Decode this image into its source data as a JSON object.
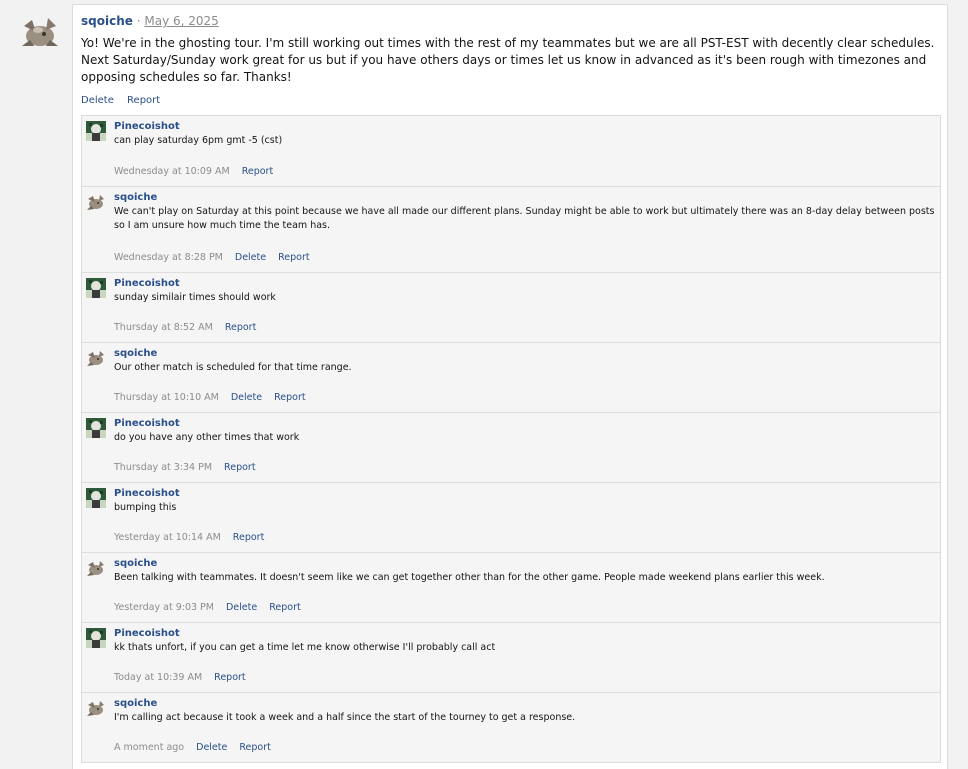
{
  "post": {
    "author": "sqoiche",
    "separator": "·",
    "date": "May 6, 2025",
    "body": "Yo! We're in the ghosting tour. I'm still working out times with the rest of my teammates but we are all PST-EST with decently clear schedules. Next Saturday/Sunday work great for us but if you have others days or times let us know in advanced as it's been rough with timezones and opposing schedules so far. Thanks!",
    "actions": {
      "delete_label": "Delete",
      "report_label": "Report"
    }
  },
  "comments": [
    {
      "author": "Pinecoishot",
      "avatar_icon": "pinecoishot-avatar-icon",
      "text": "can play saturday 6pm gmt -5 (cst)",
      "time": "Wednesday at 10:09 AM",
      "actions": [
        "Report"
      ]
    },
    {
      "author": "sqoiche",
      "avatar_icon": "sqoiche-avatar-icon",
      "text": "We can't play on Saturday at this point because we have all made our different plans. Sunday might be able to work but ultimately there was an 8-day delay between posts so I am unsure how much time the team has.",
      "time": "Wednesday at 8:28 PM",
      "actions": [
        "Delete",
        "Report"
      ]
    },
    {
      "author": "Pinecoishot",
      "avatar_icon": "pinecoishot-avatar-icon",
      "text": "sunday similair times should work",
      "time": "Thursday at 8:52 AM",
      "actions": [
        "Report"
      ]
    },
    {
      "author": "sqoiche",
      "avatar_icon": "sqoiche-avatar-icon",
      "text": "Our other match is scheduled for that time range.",
      "time": "Thursday at 10:10 AM",
      "actions": [
        "Delete",
        "Report"
      ]
    },
    {
      "author": "Pinecoishot",
      "avatar_icon": "pinecoishot-avatar-icon",
      "text": "do you have any other times that work",
      "time": "Thursday at 3:34 PM",
      "actions": [
        "Report"
      ]
    },
    {
      "author": "Pinecoishot",
      "avatar_icon": "pinecoishot-avatar-icon",
      "text": "bumping this",
      "time": "Yesterday at 10:14 AM",
      "actions": [
        "Report"
      ]
    },
    {
      "author": "sqoiche",
      "avatar_icon": "sqoiche-avatar-icon",
      "text": "Been talking with teammates. It doesn't seem like we can get together other than for the other game. People made weekend plans earlier this week.",
      "time": "Yesterday at 9:03 PM",
      "actions": [
        "Delete",
        "Report"
      ]
    },
    {
      "author": "Pinecoishot",
      "avatar_icon": "pinecoishot-avatar-icon",
      "text": "kk thats unfort, if you can get a time let me know otherwise I'll probably call act",
      "time": "Today at 10:39 AM",
      "actions": [
        "Report"
      ]
    },
    {
      "author": "sqoiche",
      "avatar_icon": "sqoiche-avatar-icon",
      "text": "I'm calling act because it took a week and a half since the start of the tourney to get a response.",
      "time": "A moment ago",
      "actions": [
        "Delete",
        "Report"
      ]
    }
  ],
  "colors": {
    "link": "#2a4f8a",
    "muted": "#8c8c8c",
    "comment_bg": "#f5f5f5",
    "page_bg": "#f2f2f2"
  }
}
